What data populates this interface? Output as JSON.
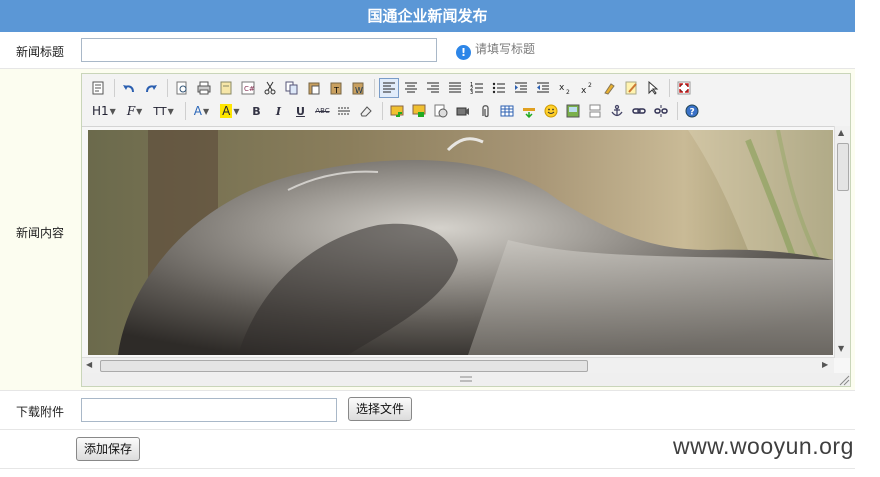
{
  "page": {
    "title": "国通企业新闻发布"
  },
  "title_row": {
    "label": "新闻标题",
    "value": "",
    "hint": "请填写标题"
  },
  "content_row": {
    "label": "新闻内容",
    "toolbar_row1": [
      "source-icon",
      "undo-icon",
      "redo-icon",
      "preview-icon",
      "print-icon",
      "template-icon",
      "code-icon",
      "cut-icon",
      "copy-icon",
      "paste-icon",
      "paste-text-icon",
      "paste-word-icon",
      "align-left-icon",
      "align-center-icon",
      "align-right-icon",
      "justify-icon",
      "ordered-list-icon",
      "unordered-list-icon",
      "indent-icon",
      "outdent-icon",
      "subscript-icon",
      "superscript-icon",
      "clear-format-icon",
      "select-all-icon",
      "pointer-icon",
      "fullscreen-icon"
    ],
    "toolbar_row2": {
      "heading": "H1",
      "font": "F",
      "size": "TT",
      "font_color": "A",
      "highlight": "A",
      "bold": "B",
      "italic": "I",
      "underline": "U",
      "strike": "ABC",
      "icons": [
        "hr-icon",
        "eraser-icon",
        "image-icon",
        "multi-image-icon",
        "flash-icon",
        "media-icon",
        "attachment-icon",
        "table-icon",
        "insert-hr-icon",
        "emoticon-icon",
        "picture-icon",
        "page-break-icon",
        "anchor-icon",
        "link-icon",
        "unlink-icon",
        "help-icon"
      ]
    },
    "image_icon_name": "koala-photo"
  },
  "attach_row": {
    "label": "下载附件",
    "choose_file_button": "选择文件"
  },
  "save_row": {
    "save_button": "添加保存"
  },
  "watermark": "www.wooyun.org",
  "colors": {
    "header_bg": "#5b97d6",
    "content_bg": "#fcfdf0",
    "info_icon": "#2d86e8"
  }
}
